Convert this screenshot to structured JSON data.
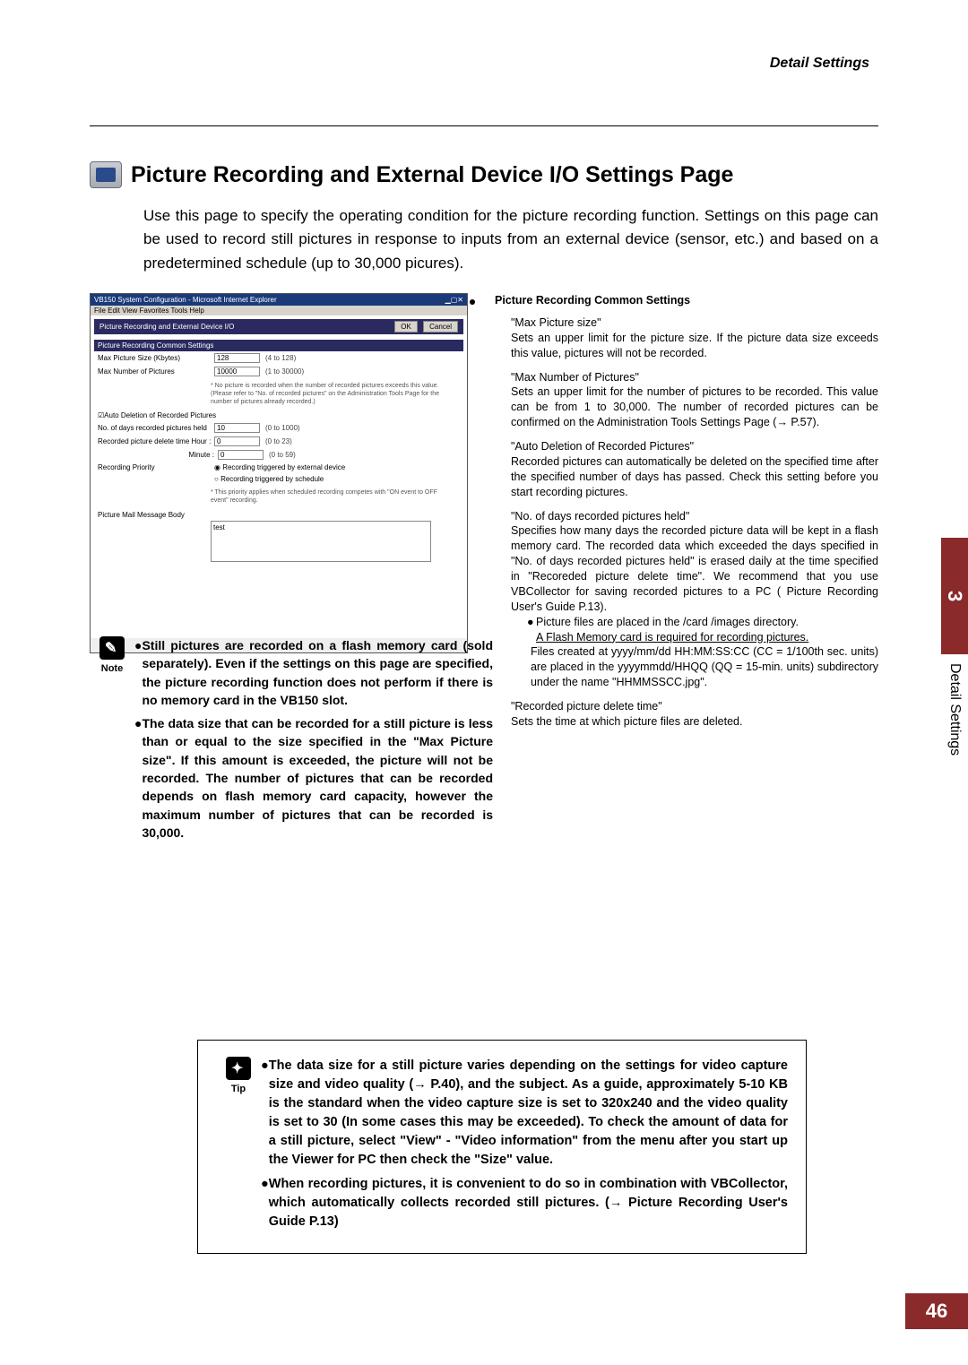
{
  "header": {
    "right": "Detail Settings"
  },
  "title": "Picture Recording and External Device I/O Settings Page",
  "intro": "Use this page to specify the operating condition for the picture recording function. Settings on this page can be used to record still pictures in response to inputs from an external device (sensor, etc.) and based on a predetermined schedule (up to 30,000 picures).",
  "screenshot": {
    "window_title": "VB150 System Configuration - Microsoft Internet Explorer",
    "menu": "File   Edit   View   Favorites   Tools   Help",
    "header": "Picture Recording and External Device I/O",
    "btn_ok": "OK",
    "btn_cancel": "Cancel",
    "section1": "Picture Recording Common Settings",
    "row1_label": "Max Picture Size (Kbytes)",
    "row1_value": "128",
    "row1_hint": "(4 to 128)",
    "row2_label": "Max Number of Pictures",
    "row2_value": "10000",
    "row2_hint": "(1 to 30000)",
    "note1": "* No picture is recorded when the number of recorded pictures exceeds this value. (Please refer to \"No. of recorded pictures\" on the Administration Tools Page for the number of pictures already recorded.)",
    "chk_label": "Auto Deletion of Recorded Pictures",
    "row3_label": "No. of days recorded pictures held",
    "row3_value": "10",
    "row3_hint": "(0 to 1000)",
    "row4_label": "Recorded picture delete time   Hour :",
    "row4_value": "0",
    "row4_hint": "(0 to 23)",
    "row4b_label": "Minute :",
    "row4b_value": "0",
    "row4b_hint": "(0 to 59)",
    "row5_label": "Recording Priority",
    "radio1": "Recording triggered by external device",
    "radio2": "Recording triggered by schedule",
    "note2": "* This priority applies when scheduled recording competes with \"ON event to OFF event\" recording.",
    "row6_label": "Picture Mail Message Body",
    "ta_content": "test"
  },
  "right": {
    "heading": "Picture Recording Common Settings",
    "b1_title": "\"Max Picture size\"",
    "b1_text": "Sets an upper limit for the picture size. If the picture data size exceeds this value, pictures will not be recorded.",
    "b2_title": "\"Max Number of Pictures\"",
    "b2_text": "Sets an upper limit for the number of pictures to be recorded. This value can be from 1 to 30,000. The number of recorded pictures can be confirmed on the Administration Tools Settings Page (→ P.57).",
    "b3_title": "\"Auto Deletion of Recorded Pictures\"",
    "b3_text": "Recorded pictures can automatically be deleted on the specified time after the specified number of days has passed. Check this setting before you start recording pictures.",
    "b4_title": "\"No. of days recorded pictures held\"",
    "b4_text": "Specifies how many days the recorded picture data will be kept in a flash memory card. The recorded data which exceeded the days specified in \"No. of days recorded pictures held\" is erased daily at the time specified in \"Recoreded picture delete time\". We recommend that you use VBCollector for saving recorded pictures to a PC ( Picture Recording User's Guide P.13).",
    "sub1": "Picture files are placed in the /card /images directory.",
    "sub2": "A Flash Memory card is required for recording pictures.",
    "sub3": "Files created at yyyy/mm/dd HH:MM:SS:CC (CC = 1/100th sec. units) are placed in the yyyymmdd/HHQQ (QQ = 15-min. units) subdirectory under the name \"HHMMSSCC.jpg\".",
    "b5_title": "\"Recorded picture delete time\"",
    "b5_text": "Sets the time at which picture files are deleted."
  },
  "note": {
    "label": "Note",
    "item1": "Still pictures are recorded on a flash memory card (sold separately). Even if the settings on this page are specified, the picture recording function does not perform if there is no memory card in the VB150 slot.",
    "item2": "The data size that can be recorded for a still picture is less than or equal to the size specified in the \"Max Picture size\". If this amount is exceeded, the picture will not be recorded. The number of pictures that can be recorded depends on flash memory card capacity, however the maximum number of pictures that can be recorded is 30,000."
  },
  "tip": {
    "label": "Tip",
    "item1": "The data size for a still picture varies depending on the settings for video capture size and video quality (→ P.40), and the subject. As a guide, approximately 5-10 KB is the standard when the video capture size is set to 320x240 and the video quality is set to 30 (In some cases this may be exceeded). To check the amount of data for a still picture, select \"View\" - \"Video information\" from the menu after you start up the Viewer for PC then check the \"Size\" value.",
    "item2": "When recording pictures, it is convenient to do so in combination with VBCollector, which automatically collects recorded still pictures. (→ Picture Recording User's Guide P.13)"
  },
  "side": {
    "tab": "3",
    "label": "Detail Settings"
  },
  "page_number": "46"
}
